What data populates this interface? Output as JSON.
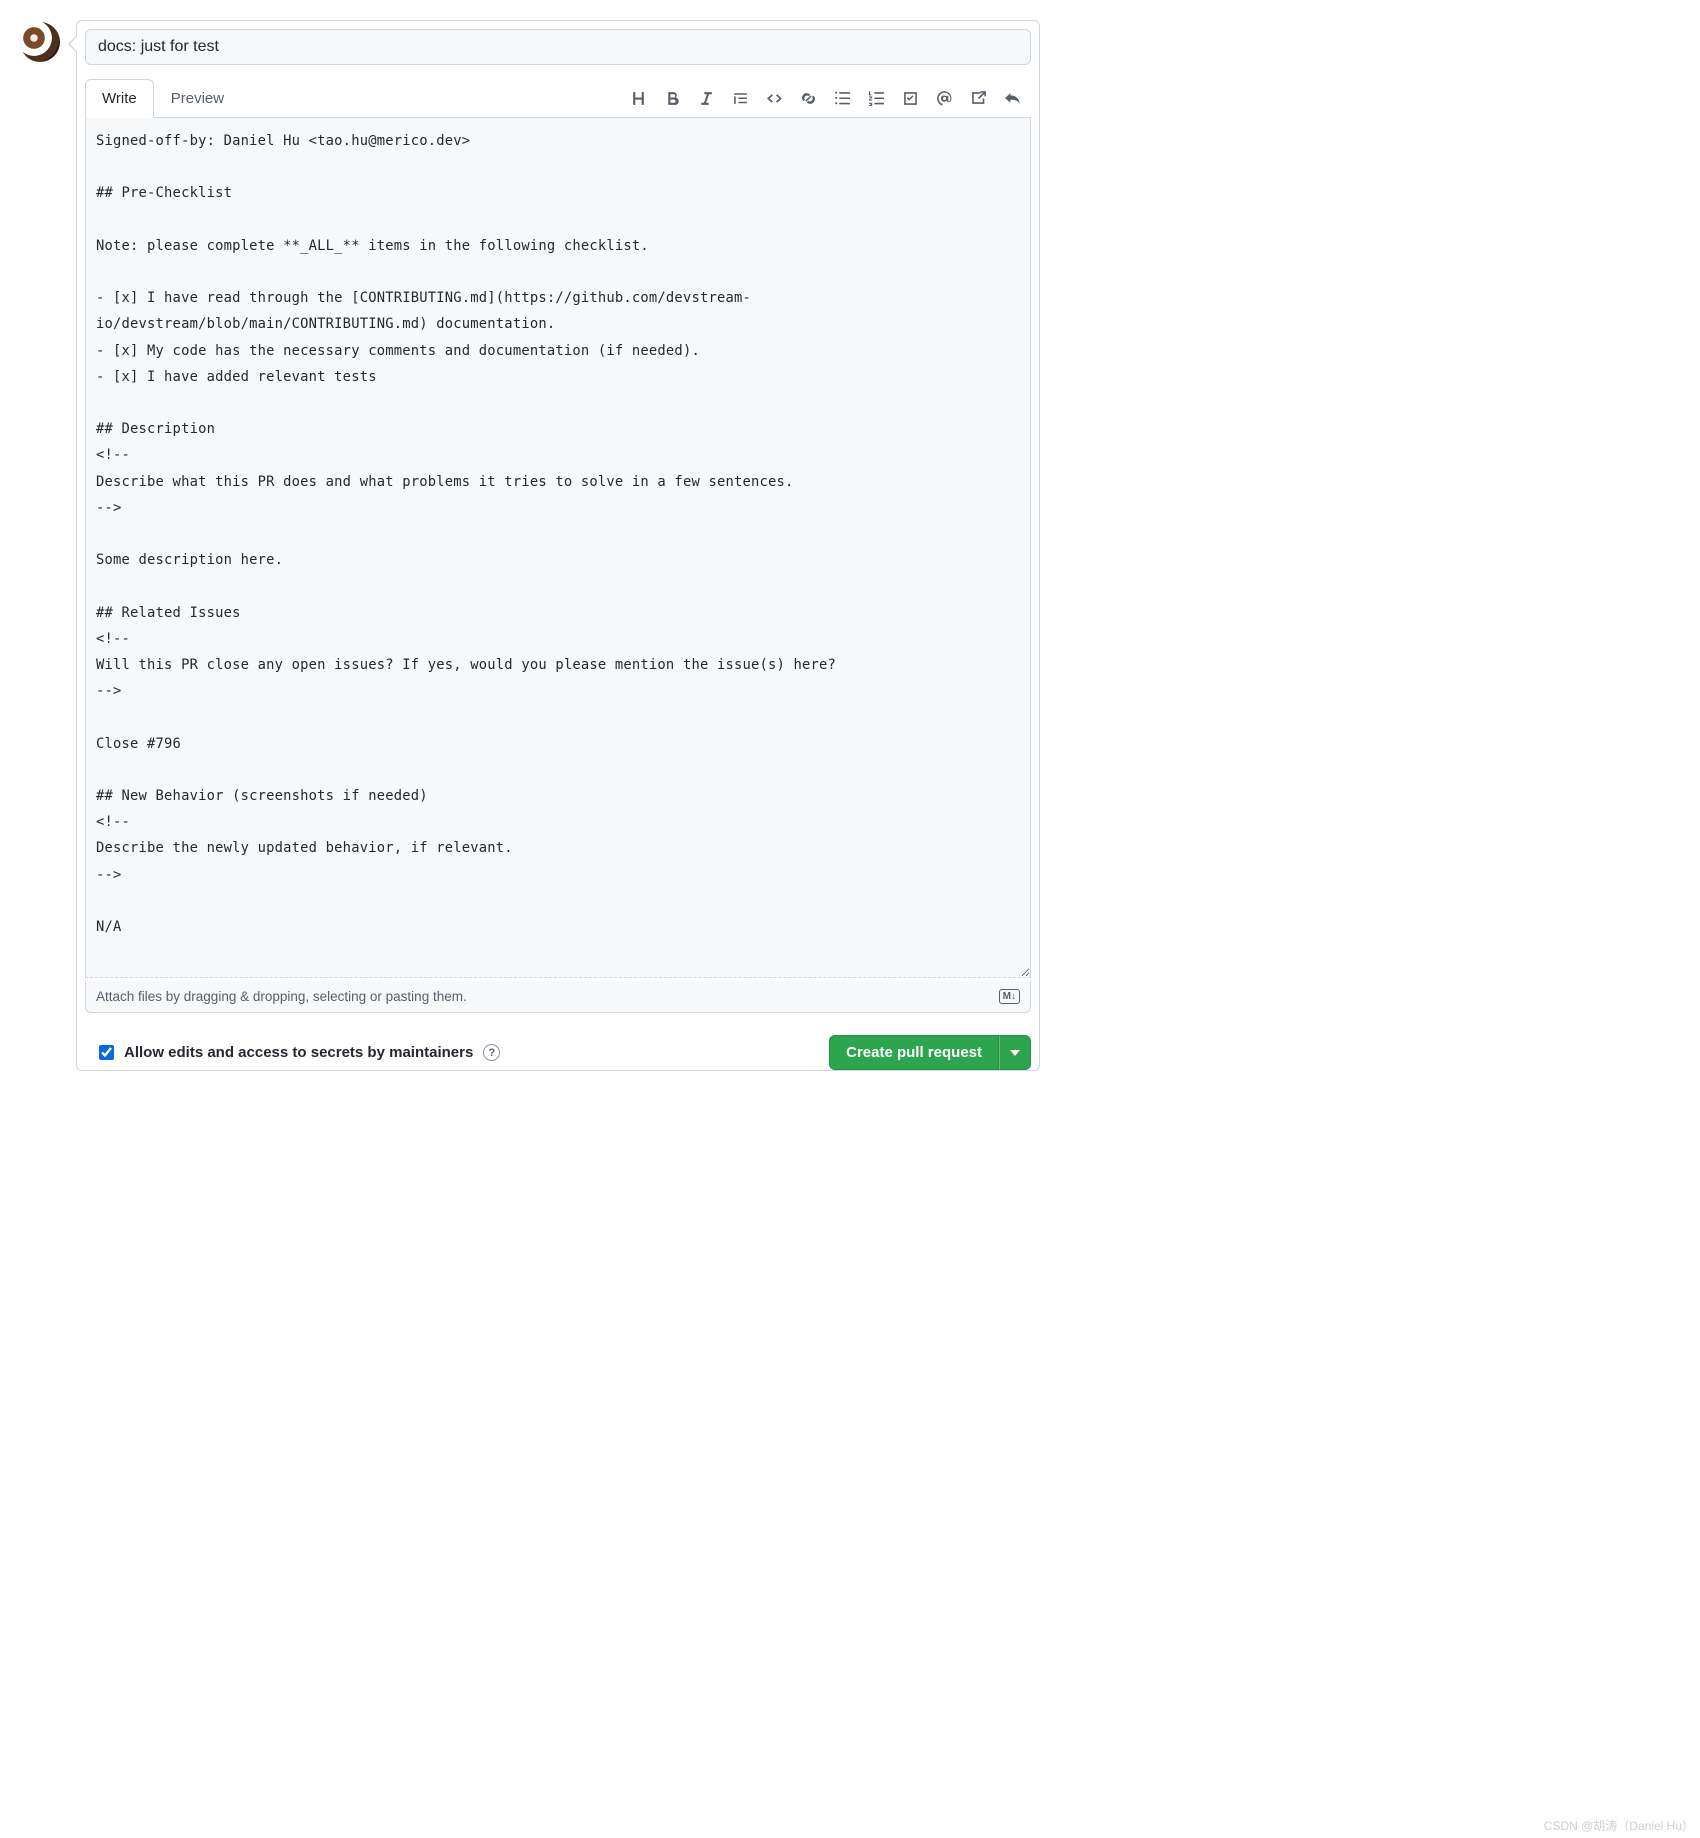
{
  "pr": {
    "title_value": "docs: just for test",
    "title_placeholder": "Title",
    "tabs": {
      "write": "Write",
      "preview": "Preview"
    },
    "toolbar_icons": [
      "heading",
      "bold",
      "italic",
      "quote",
      "code",
      "link",
      "unordered-list",
      "ordered-list",
      "task-list",
      "mention",
      "cross-reference",
      "reply"
    ],
    "body": "Signed-off-by: Daniel Hu <tao.hu@merico.dev>\n\n## Pre-Checklist\n\nNote: please complete **_ALL_** items in the following checklist.\n\n- [x] I have read through the [CONTRIBUTING.md](https://github.com/devstream-io/devstream/blob/main/CONTRIBUTING.md) documentation.\n- [x] My code has the necessary comments and documentation (if needed).\n- [x] I have added relevant tests\n\n## Description\n<!--\nDescribe what this PR does and what problems it tries to solve in a few sentences.\n-->\n\nSome description here.\n\n## Related Issues\n<!--\nWill this PR close any open issues? If yes, would you please mention the issue(s) here?\n-->\n\nClose #796\n\n## New Behavior (screenshots if needed)\n<!--\nDescribe the newly updated behavior, if relevant.\n-->\n\nN/A\n",
    "attach_hint": "Attach files by dragging & dropping, selecting or pasting them.",
    "markdown_badge": "M↓",
    "allow_edits_label": "Allow edits and access to secrets by maintainers",
    "allow_edits_checked": true,
    "create_button": "Create pull request"
  },
  "watermark": "CSDN @胡涛（Daniel Hu）"
}
